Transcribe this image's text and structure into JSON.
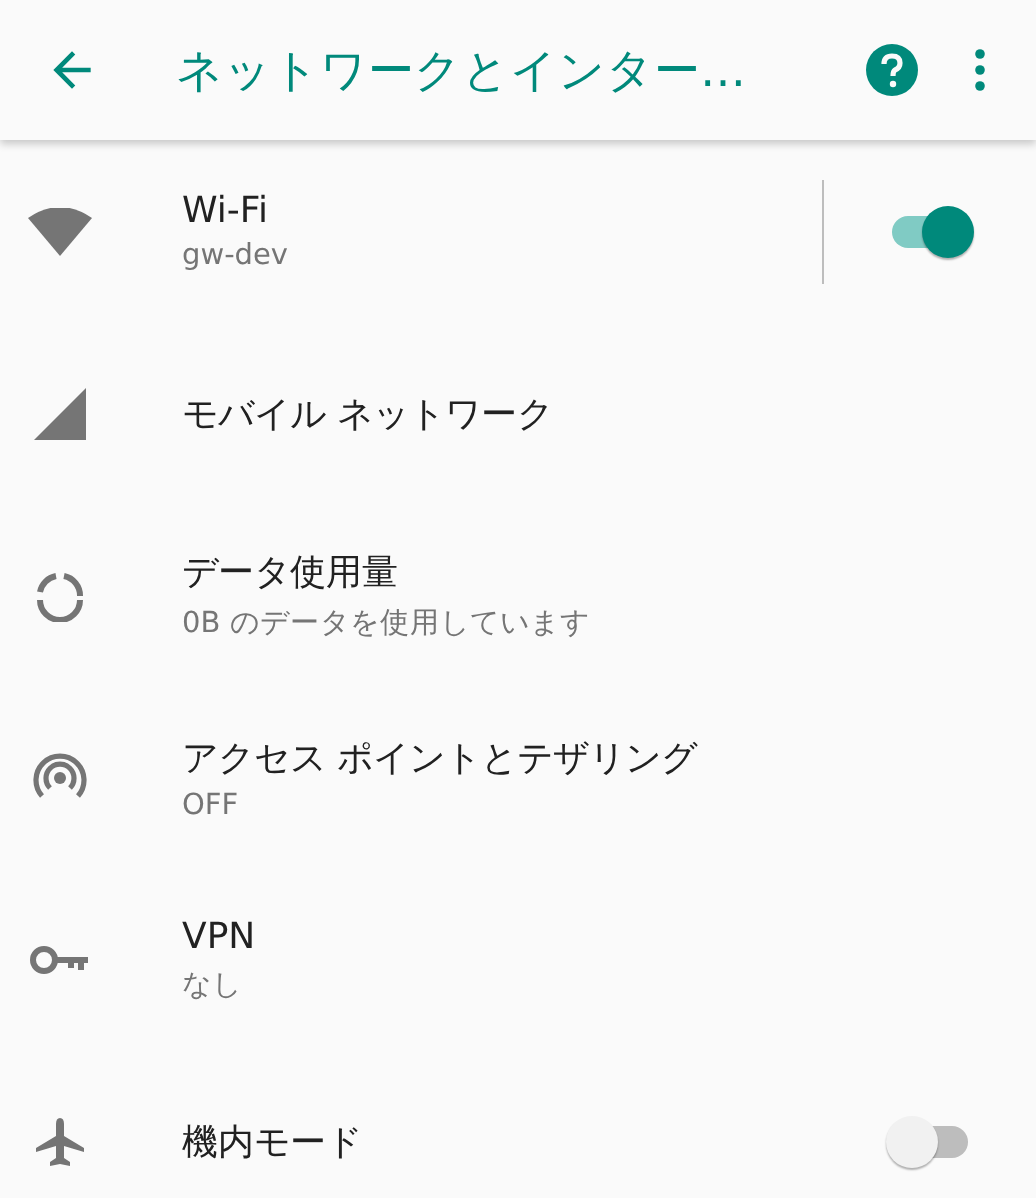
{
  "app_bar": {
    "title": "ネットワークとインター…"
  },
  "items": [
    {
      "kind": "split-switch",
      "title": "Wi-Fi",
      "subtitle": "gw-dev",
      "on": true
    },
    {
      "kind": "plain",
      "title": "モバイル ネットワーク"
    },
    {
      "kind": "plain",
      "title": "データ使用量",
      "subtitle": "0B のデータを使用しています"
    },
    {
      "kind": "plain",
      "title": "アクセス ポイントとテザリング",
      "subtitle": "OFF"
    },
    {
      "kind": "plain",
      "title": "VPN",
      "subtitle": "なし"
    },
    {
      "kind": "switch",
      "title": "機内モード",
      "on": false
    }
  ]
}
